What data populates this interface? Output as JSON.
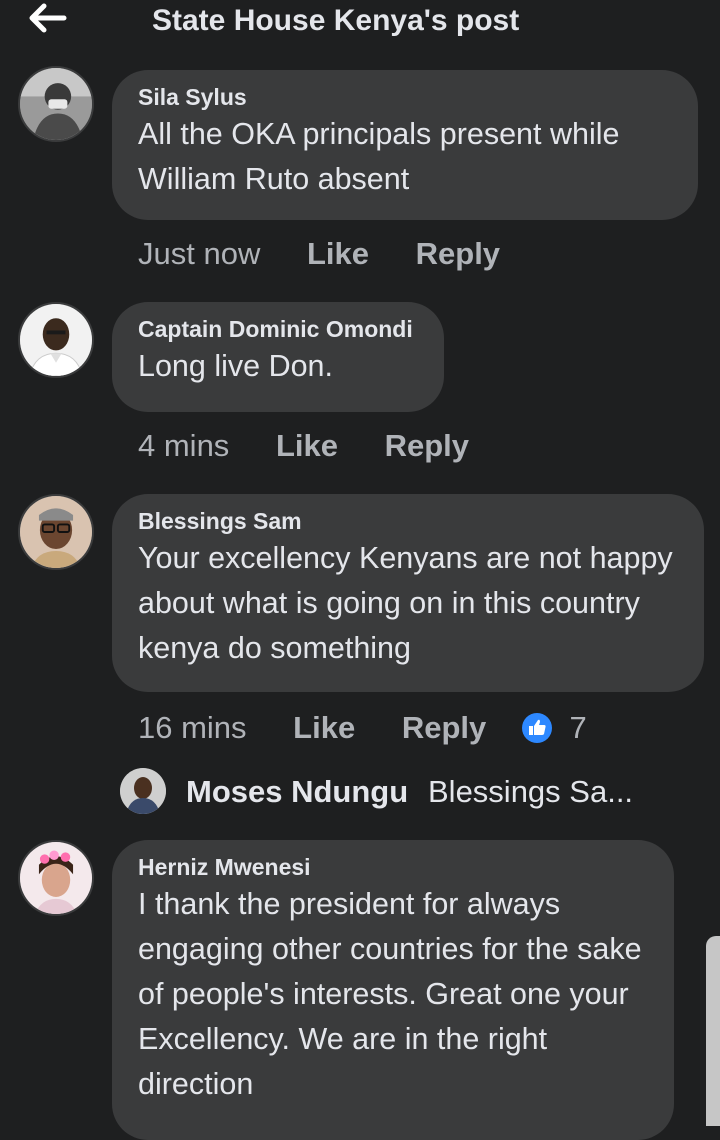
{
  "header": {
    "title": "State House Kenya's post",
    "back_icon": "arrow-left-icon"
  },
  "comments": [
    {
      "author": "Sila Sylus",
      "text": "All the OKA principals present while William Ruto absent",
      "time": "Just now",
      "like_label": "Like",
      "reply_label": "Reply"
    },
    {
      "author": "Captain Dominic Omondi",
      "text": "Long live Don.",
      "time": "4 mins",
      "like_label": "Like",
      "reply_label": "Reply"
    },
    {
      "author": "Blessings Sam",
      "text": "Your excellency  Kenyans are not happy about what is going on in this country kenya do something",
      "time": "16 mins",
      "like_label": "Like",
      "reply_label": "Reply",
      "reaction_icon": "thumbs-up-icon",
      "reaction_count": "7",
      "reply_preview": {
        "author": "Moses Ndungu",
        "text": "Blessings Sa..."
      }
    },
    {
      "author": "Herniz Mwenesi",
      "text": "I thank the president for always engaging other countries for the sake of people's interests. Great one your Excellency. We are in the right direction"
    }
  ],
  "colors": {
    "background": "#1e1f20",
    "bubble": "#3a3b3c",
    "primary_text": "#e4e6eb",
    "secondary_text": "#b0b3b8",
    "like_blue": "#2d88ff"
  }
}
